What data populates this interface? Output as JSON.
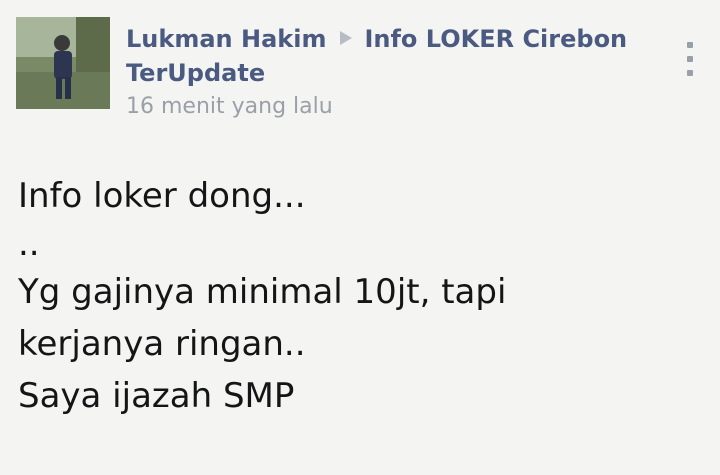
{
  "post": {
    "author": "Lukman Hakim",
    "group": "Info LOKER Cirebon TerUpdate",
    "timestamp": "16 menit yang lalu",
    "lines": [
      "Info loker dong...",
      "..",
      "Yg gajinya minimal 10jt, tapi",
      "kerjanya ringan..",
      "Saya ijazah SMP"
    ]
  },
  "colors": {
    "author_link": "#4a5a80",
    "timestamp": "#9aa0a8",
    "text": "#151515",
    "background": "#f4f5f3"
  },
  "icons": {
    "separator": "triangle-right-icon",
    "menu": "more-vertical-icon"
  }
}
